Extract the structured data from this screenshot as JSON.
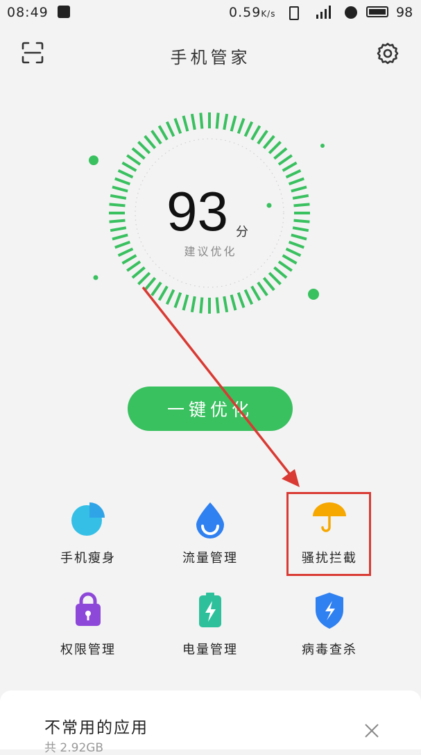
{
  "status_bar": {
    "time": "08:49",
    "net_speed": "0.59",
    "net_speed_unit": "K/s",
    "battery_level": "98"
  },
  "appbar": {
    "title": "手机管家"
  },
  "score": {
    "value": "93",
    "unit": "分",
    "note": "建议优化"
  },
  "optimize_button": {
    "label": "一键优化"
  },
  "tools": [
    {
      "label": "手机瘦身",
      "icon": "pie-chart-icon"
    },
    {
      "label": "流量管理",
      "icon": "water-drop-icon"
    },
    {
      "label": "骚扰拦截",
      "icon": "umbrella-icon"
    },
    {
      "label": "权限管理",
      "icon": "lock-icon"
    },
    {
      "label": "电量管理",
      "icon": "battery-icon"
    },
    {
      "label": "病毒查杀",
      "icon": "shield-icon"
    }
  ],
  "card": {
    "title": "不常用的应用",
    "subtitle": "共 2.92GB"
  },
  "colors": {
    "accent": "#39c05f",
    "highlight": "#d93a33",
    "umbrella": "#f6a700"
  }
}
